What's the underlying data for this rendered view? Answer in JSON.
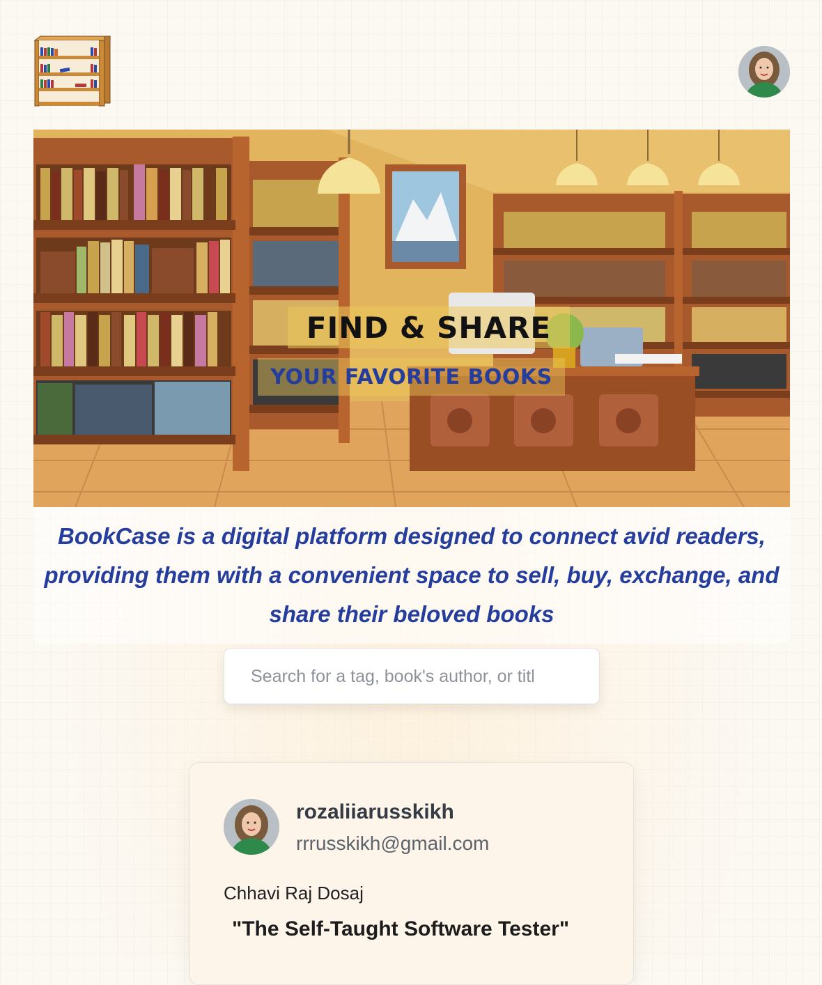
{
  "header": {
    "logo_icon": "bookshelf-icon",
    "profile_avatar_icon": "user-avatar"
  },
  "hero": {
    "title": "FIND & SHARE",
    "subtitle": "YOUR FAVORITE BOOKS",
    "illustration": "library-illustration"
  },
  "tagline": "BookCase is a digital platform designed to connect avid readers, providing them with a convenient space to sell, buy, exchange, and share their beloved books",
  "search": {
    "placeholder": "Search for a tag, book's author, or title",
    "value": ""
  },
  "post": {
    "username": "rozaliiarusskikh",
    "email": "rrrusskikh@gmail.com",
    "author": "Chhavi Raj Dosaj",
    "title": "\"The Self-Taught Software Tester\""
  },
  "colors": {
    "accent_blue": "#253d9c",
    "card_bg": "#fdf5ea",
    "page_bg": "#fcf8f2"
  }
}
